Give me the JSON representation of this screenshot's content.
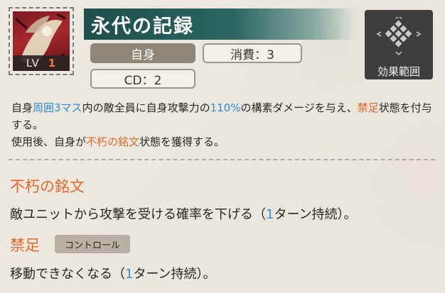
{
  "skill": {
    "level_label": "LV",
    "level_value": "1",
    "title": "永代の記録",
    "tag_target": "自身",
    "tag_cost": "消費：3",
    "tag_cd": "CD：2",
    "area_button_label": "効果範囲"
  },
  "description": {
    "line1": [
      {
        "t": "自身",
        "c": "normal"
      },
      {
        "t": "周囲3マス",
        "c": "blue"
      },
      {
        "t": "内の敵全員に自身攻撃力の",
        "c": "normal"
      },
      {
        "t": "110%",
        "c": "blue"
      },
      {
        "t": "の構素ダメージを与え、",
        "c": "normal"
      },
      {
        "t": "禁足",
        "c": "orange"
      },
      {
        "t": "状態を付与する。",
        "c": "normal"
      }
    ],
    "line2": [
      {
        "t": "使用後、自身が",
        "c": "normal"
      },
      {
        "t": "不朽の銘文",
        "c": "orange"
      },
      {
        "t": "状態を獲得する。",
        "c": "normal"
      }
    ]
  },
  "status1": {
    "name": "不朽の銘文",
    "desc_pre": "敵ユニットから攻撃を受ける確率を下げる（",
    "desc_num": "1",
    "desc_post": "ターン持続）。"
  },
  "status2": {
    "name": "禁足",
    "tag": "コントロール",
    "desc_pre": "移動できなくなる（",
    "desc_num": "1",
    "desc_post": "ターン持続）。"
  },
  "colors": {
    "accent_blue": "#2b8fd8",
    "accent_orange": "#e8662a",
    "title_bar": "#1e4f4c"
  },
  "icons": {
    "skill_icon": "skill-portrait-icon",
    "area_icon": "diamond-grid-icon"
  }
}
